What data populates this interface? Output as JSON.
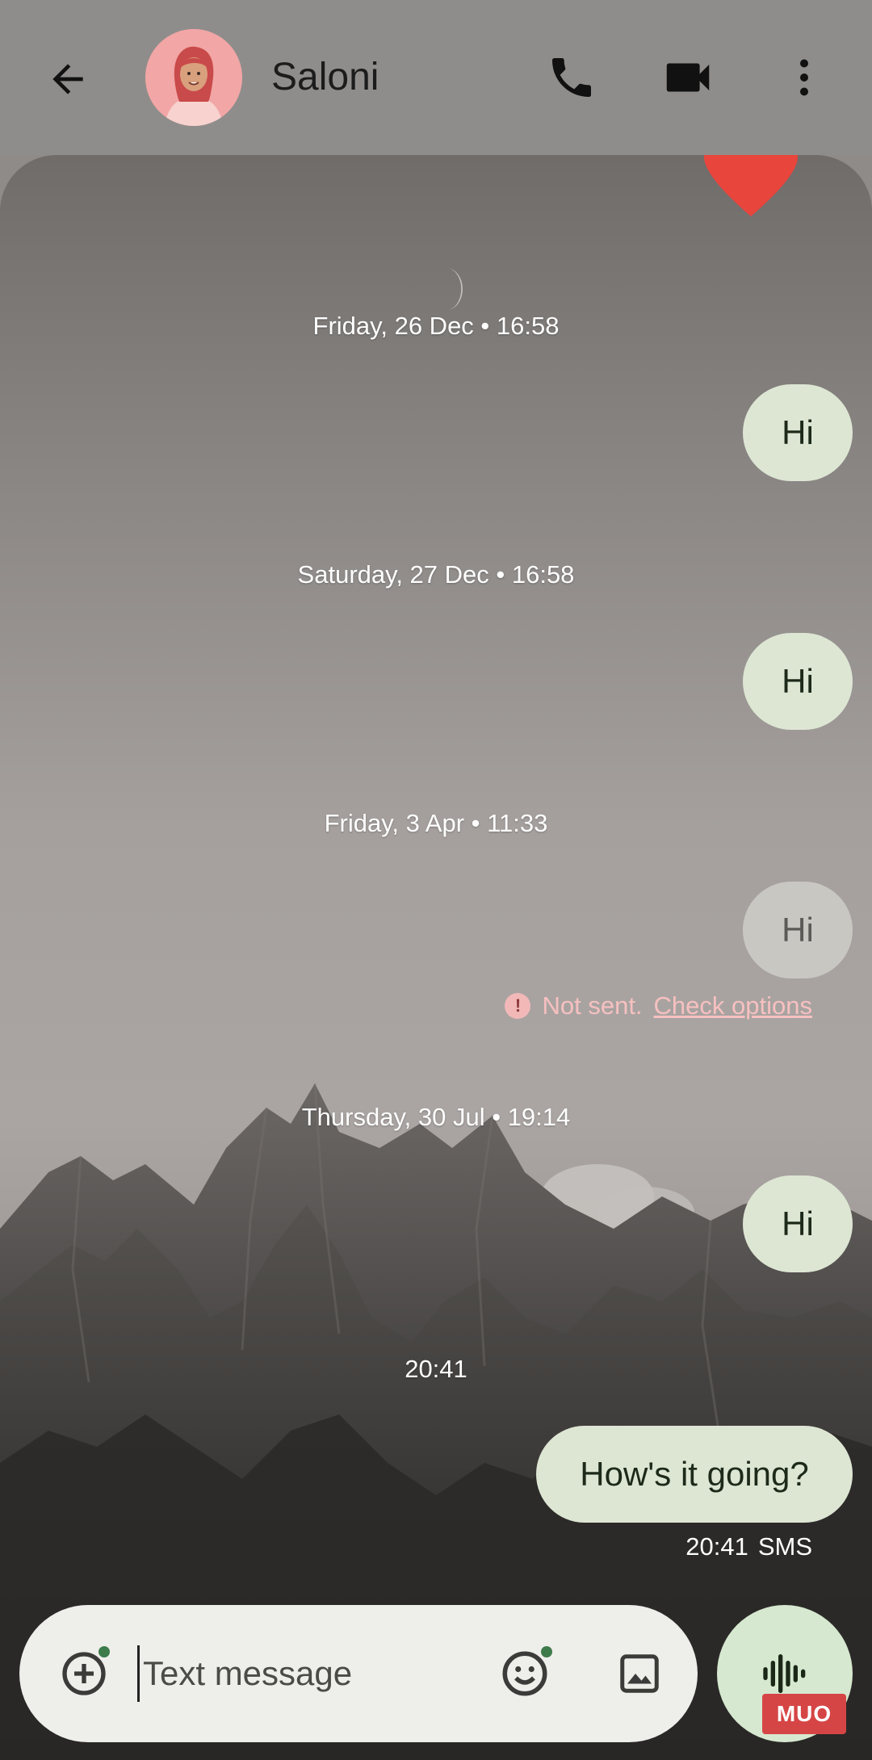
{
  "header": {
    "contact_name": "Saloni",
    "back_icon": "arrow-back-icon",
    "call_icon": "phone-icon",
    "video_icon": "videocam-icon",
    "more_icon": "more-vert-icon"
  },
  "messages": [
    {
      "date": "Friday, 26 Dec • 16:58",
      "text": "Hi"
    },
    {
      "date": "Saturday, 27 Dec • 16:58",
      "text": "Hi"
    },
    {
      "date": "Friday, 3 Apr • 11:33",
      "text": "Hi",
      "status": "failed"
    },
    {
      "date": "Thursday, 30 Jul • 19:14",
      "text": "Hi"
    },
    {
      "date": "20:41",
      "text": "How's it going?"
    }
  ],
  "error": {
    "text": "Not sent.",
    "link": "Check options",
    "icon": "error-icon"
  },
  "last_meta": {
    "time": "20:41",
    "type": "SMS"
  },
  "compose": {
    "placeholder": "Text message",
    "attach_icon": "add-circle-icon",
    "emoji_icon": "emoji-icon",
    "gallery_icon": "image-icon",
    "voice_icon": "voice-waveform-icon"
  },
  "watermark": "MUO",
  "colors": {
    "outgoing_bubble": "#dde6d3",
    "failed_bubble": "#c9c7c2",
    "error_text": "#f7c0c0",
    "voice_button": "#d6e8cf"
  }
}
